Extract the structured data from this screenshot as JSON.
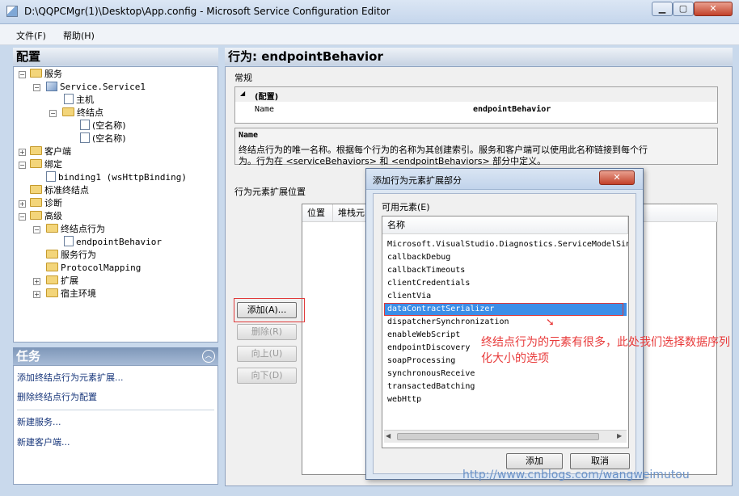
{
  "window": {
    "title": "D:\\QQPCMgr(1)\\Desktop\\App.config - Microsoft Service Configuration Editor"
  },
  "menu": {
    "file": "文件(F)",
    "help": "帮助(H)"
  },
  "config": {
    "header": "配置",
    "tree": [
      {
        "label": "服务",
        "icon": "folder-icon"
      },
      {
        "label": "Service.Service1",
        "icon": "service-icon"
      },
      {
        "label": "主机",
        "icon": "document-icon"
      },
      {
        "label": "终结点",
        "icon": "folder-icon"
      },
      {
        "label": "(空名称)",
        "icon": "endpoint-icon"
      },
      {
        "label": "(空名称)",
        "icon": "endpoint-icon"
      },
      {
        "label": "客户端",
        "icon": "folder-icon"
      },
      {
        "label": "绑定",
        "icon": "folder-icon"
      },
      {
        "label": "binding1 (wsHttpBinding)",
        "icon": "binding-icon"
      },
      {
        "label": "标准终结点",
        "icon": "folder-icon"
      },
      {
        "label": "诊断",
        "icon": "folder-icon"
      },
      {
        "label": "高级",
        "icon": "folder-icon"
      },
      {
        "label": "终结点行为",
        "icon": "folder-icon"
      },
      {
        "label": "endpointBehavior",
        "icon": "behavior-icon"
      },
      {
        "label": "服务行为",
        "icon": "folder-icon"
      },
      {
        "label": "ProtocolMapping",
        "icon": "folder-icon"
      },
      {
        "label": "扩展",
        "icon": "folder-icon"
      },
      {
        "label": "宿主环境",
        "icon": "folder-icon"
      }
    ]
  },
  "tasks": {
    "header": "任务",
    "items": [
      "添加终结点行为元素扩展...",
      "删除终结点行为配置",
      "新建服务...",
      "新建客户端..."
    ]
  },
  "main": {
    "header": "行为: endpointBehavior",
    "general_label": "常规",
    "property_grid": {
      "category": "(配置)",
      "name_label": "Name",
      "name_value": "endpointBehavior"
    },
    "description": {
      "title": "Name",
      "line1": "终结点行为的唯一名称。根据每个行为的名称为其创建索引。服务和客户端可以使用此名称链接到每个行",
      "line2": "为。行为在 <serviceBehaviors> 和 <endpointBehaviors> 部分中定义。"
    },
    "ext_label": "行为元素扩展位置",
    "columns": [
      "位置",
      "堆栈元"
    ],
    "buttons": {
      "add": "添加(A)...",
      "remove": "删除(R)",
      "up": "向上(U)",
      "down": "向下(D)"
    }
  },
  "dialog": {
    "title": "添加行为元素扩展部分",
    "available_label": "可用元素(E)",
    "column_name": "名称",
    "items": [
      "Microsoft.VisualStudio.Diagnostics.ServiceModelSink",
      "callbackDebug",
      "callbackTimeouts",
      "clientCredentials",
      "clientVia",
      "dataContractSerializer",
      "dispatcherSynchronization",
      "enableWebScript",
      "endpointDiscovery",
      "soapProcessing",
      "synchronousReceive",
      "transactedBatching",
      "webHttp"
    ],
    "selected_index": 5,
    "add": "添加",
    "cancel": "取消"
  },
  "annotation": "终结点行为的元素有很多，此处我们选择数据序列化大小的选项",
  "watermark": "http://www.cnblogs.com/wangweimutou",
  "colors": {
    "selection": "#3b8ee8",
    "annotation": "#e83a3a"
  }
}
